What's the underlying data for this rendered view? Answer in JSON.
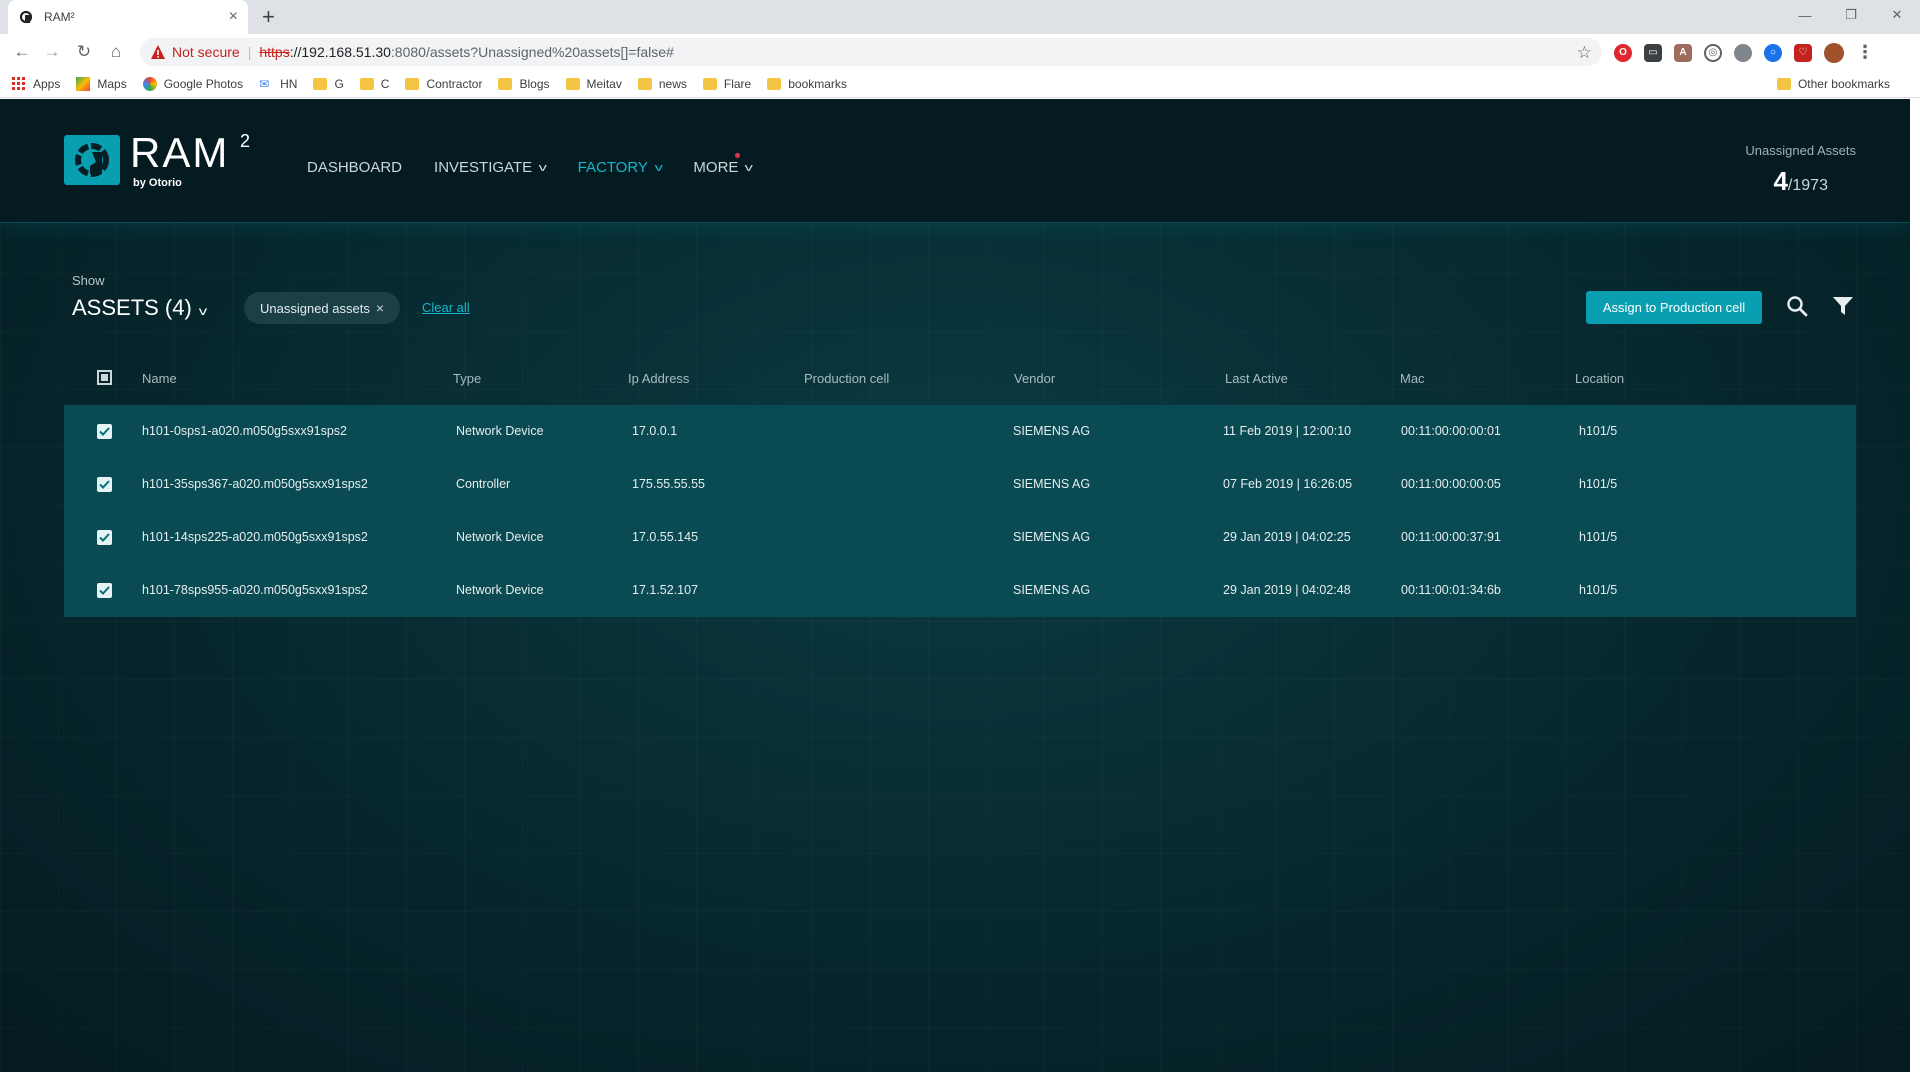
{
  "browser": {
    "tab_title": "RAM²",
    "not_secure": "Not secure",
    "url_scheme": "https",
    "url_host": "://192.168.51.30",
    "url_rest": ":8080/assets?Unassigned%20assets[]=false#"
  },
  "bookmarks": {
    "items": [
      "Apps",
      "Maps",
      "Google Photos",
      "HN",
      "G",
      "C",
      "Contractor",
      "Blogs",
      "Meitav",
      "news",
      "Flare",
      "bookmarks"
    ],
    "other": "Other bookmarks"
  },
  "header": {
    "logo": "RAM",
    "logo_sup": "2",
    "logo_sub": "by Otorio",
    "nav": [
      {
        "label": "DASHBOARD"
      },
      {
        "label": "INVESTIGATE"
      },
      {
        "label": "FACTORY"
      },
      {
        "label": "MORE"
      }
    ],
    "unassigned_label": "Unassigned Assets",
    "unassigned_count": "4",
    "unassigned_total": "/1973"
  },
  "filters": {
    "show_label": "Show",
    "assets_title": "ASSETS (4)",
    "chip_label": "Unassigned assets",
    "clear_all": "Clear all",
    "assign_button": "Assign to Production cell"
  },
  "table": {
    "columns": [
      "Name",
      "Type",
      "Ip Address",
      "Production cell",
      "Vendor",
      "Last Active",
      "Mac",
      "Location"
    ],
    "rows": [
      {
        "name": "h101-0sps1-a020.m050g5sxx91sps2",
        "type": "Network Device",
        "ip": "17.0.0.1",
        "cell": "",
        "vendor": "SIEMENS AG",
        "last_active": "11 Feb 2019 | 12:00:10",
        "mac": "00:11:00:00:00:01",
        "location": "h101/5",
        "checked": true
      },
      {
        "name": "h101-35sps367-a020.m050g5sxx91sps2",
        "type": "Controller",
        "ip": "175.55.55.55",
        "cell": "",
        "vendor": "SIEMENS AG",
        "last_active": "07 Feb 2019 | 16:26:05",
        "mac": "00:11:00:00:00:05",
        "location": "h101/5",
        "checked": true
      },
      {
        "name": "h101-14sps225-a020.m050g5sxx91sps2",
        "type": "Network Device",
        "ip": "17.0.55.145",
        "cell": "",
        "vendor": "SIEMENS AG",
        "last_active": "29 Jan 2019 | 04:02:25",
        "mac": "00:11:00:00:37:91",
        "location": "h101/5",
        "checked": true
      },
      {
        "name": "h101-78sps955-a020.m050g5sxx91sps2",
        "type": "Network Device",
        "ip": "17.1.52.107",
        "cell": "",
        "vendor": "SIEMENS AG",
        "last_active": "29 Jan 2019 | 04:02:48",
        "mac": "00:11:00:01:34:6b",
        "location": "h101/5",
        "checked": true
      }
    ]
  },
  "colors": {
    "accent": "#0a9fb0",
    "active_nav": "#16b6c9",
    "background": "#06252b",
    "row_bg": "#0a4a52"
  },
  "icons": [
    "ram-logo-icon",
    "search-icon",
    "filter-icon",
    "chevron-down-icon",
    "checkbox-checked-icon",
    "warning-icon",
    "star-icon"
  ]
}
